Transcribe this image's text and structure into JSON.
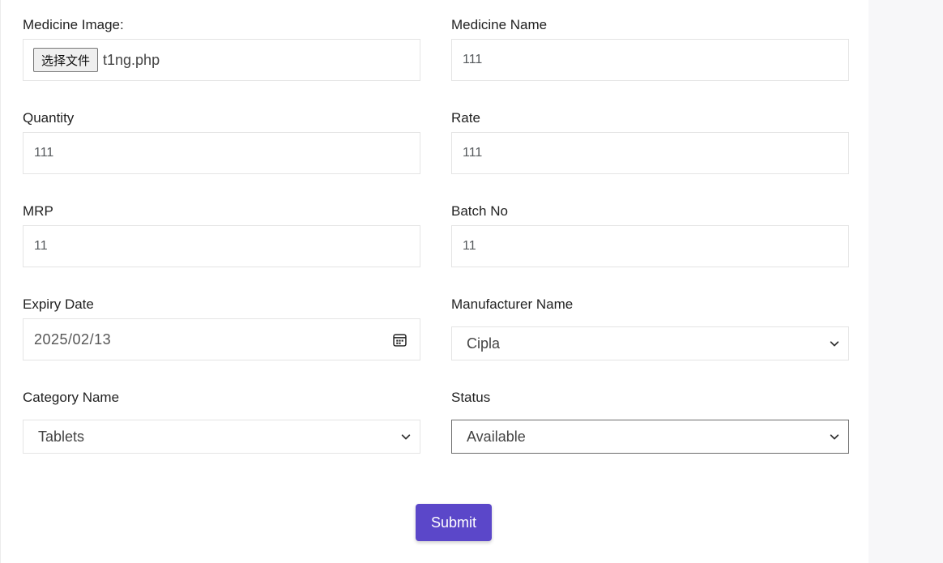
{
  "form": {
    "image": {
      "label": "Medicine Image:",
      "button": "选择文件",
      "file_name": "t1ng.php"
    },
    "name": {
      "label": "Medicine Name",
      "value": "111"
    },
    "quantity": {
      "label": "Quantity",
      "value": "111"
    },
    "rate": {
      "label": "Rate",
      "value": "111"
    },
    "mrp": {
      "label": "MRP",
      "value": "11"
    },
    "batch": {
      "label": "Batch No",
      "value": "11"
    },
    "expiry": {
      "label": "Expiry Date",
      "value": "2025/02/13"
    },
    "manufacturer": {
      "label": "Manufacturer Name",
      "selected": "Cipla"
    },
    "category": {
      "label": "Category Name",
      "selected": "Tablets"
    },
    "status": {
      "label": "Status",
      "selected": "Available"
    },
    "submit_label": "Submit"
  },
  "icons": {
    "date_picker": "calendar-icon",
    "select_arrow": "chevron-down-icon"
  },
  "colors": {
    "accent": "#5b47c9",
    "border": "#e4e4e4",
    "page_bg": "#f7f7f9"
  }
}
